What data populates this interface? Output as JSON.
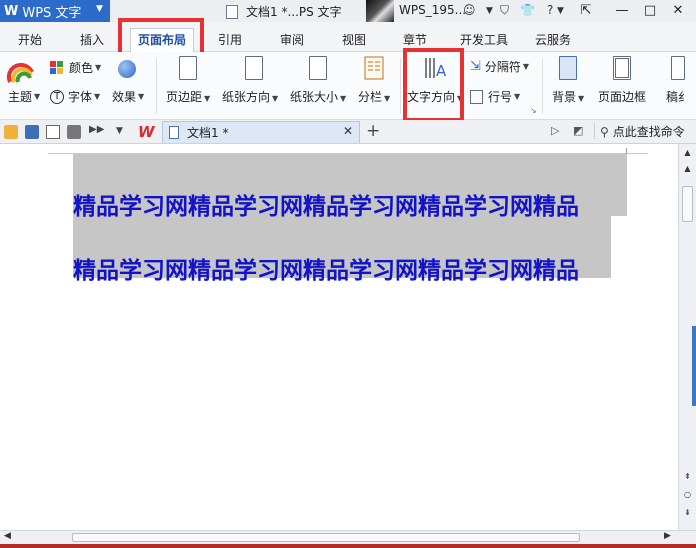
{
  "titlebar": {
    "logo_mark": "W",
    "app_name": "WPS 文字",
    "doc_title": "文档1 *...PS 文字",
    "user_name": "WPS_195...",
    "help": "?"
  },
  "menu": {
    "tabs": [
      "开始",
      "插入",
      "页面布局",
      "引用",
      "审阅",
      "视图",
      "章节",
      "开发工具",
      "云服务"
    ],
    "active": "页面布局"
  },
  "ribbon": {
    "theme": "主题",
    "color": "颜色",
    "font": "字体",
    "effect": "效果",
    "margin": "页边距",
    "orientation": "纸张方向",
    "size": "纸张大小",
    "columns": "分栏",
    "text_direction": "文字方向",
    "separator": "分隔符",
    "line_number": "行号",
    "background": "背景",
    "page_border": "页面边框",
    "draft": "稿纟"
  },
  "quickbar": {
    "doc_tab": "文档1 *",
    "find_command": "点此查找命令"
  },
  "document": {
    "line1": "精品学习网精品学习网精品学习网精品学习网精品",
    "line2": "精品学习网精品学习网精品学习网精品学习网精品"
  },
  "colors": {
    "accent": "#2c6bc9",
    "highlight_box": "#e53232",
    "text_color": "#1212c8",
    "selection": "#c6c6c6"
  }
}
